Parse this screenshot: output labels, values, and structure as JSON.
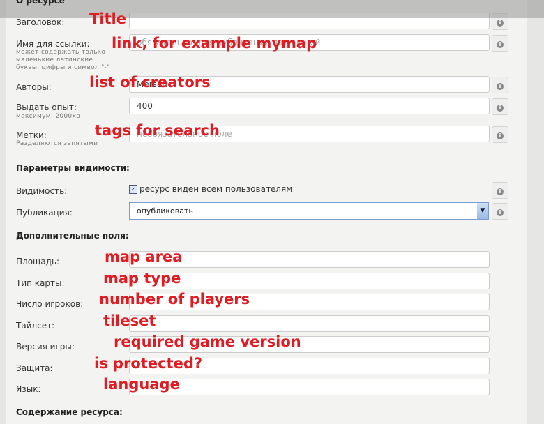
{
  "section_resource": "О ресурсе",
  "fields": [
    {
      "label": "Заголовок:",
      "value": "",
      "placeholder": "",
      "annotation": "Title"
    },
    {
      "label": "Имя для ссылки:",
      "hint": "может содержать только маленькие латинские буквы, цифры и символ \"-\"",
      "placeholder": "обязательно, для публикации латиницей",
      "annotation": "link, for example mymap"
    },
    {
      "label": "Авторы:",
      "value": "Mersah",
      "annotation": "list of creators"
    },
    {
      "label": "Выдать опыт:",
      "hint": "максимум: 2000xp",
      "value": "400"
    },
    {
      "label": "Метки:",
      "hint": "Разделяются запятыми",
      "placeholder": "необязательное поле",
      "annotation": "tags for search"
    }
  ],
  "visibility": {
    "title": "Параметры видимости:",
    "visibility_label": "Видимость:",
    "checkbox_label": "ресурс виден всем пользователям",
    "checked": true,
    "publication_label": "Публикация:",
    "publication_value": "опубликовать"
  },
  "extra": {
    "title": "Дополнительные поля:",
    "fields": [
      {
        "label": "Площадь:",
        "annotation": "map area"
      },
      {
        "label": "Тип карты:",
        "annotation": "map type"
      },
      {
        "label": "Число игроков:",
        "annotation": "number of players"
      },
      {
        "label": "Тайлсет:",
        "annotation": "tileset"
      },
      {
        "label": "Версия игры:",
        "annotation": "required game version"
      },
      {
        "label": "Защита:",
        "annotation": "is protected?"
      },
      {
        "label": "Язык:",
        "annotation": "language"
      }
    ]
  },
  "content_title": "Содержание ресурса:",
  "colors": {
    "annotation": "#e01b22"
  }
}
